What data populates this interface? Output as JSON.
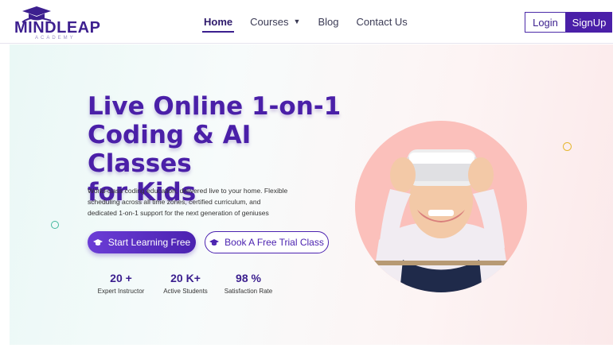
{
  "brand": {
    "name": "MINDLEAP",
    "sub": "ACADEMY",
    "accent": "#4a1fa8"
  },
  "nav": {
    "items": [
      {
        "label": "Home",
        "active": true
      },
      {
        "label": "Courses",
        "dropdown": true
      },
      {
        "label": "Blog"
      },
      {
        "label": "Contact Us"
      }
    ]
  },
  "auth": {
    "login": "Login",
    "signup": "SignUp"
  },
  "hero": {
    "title_line1": "Live Online 1-on-1",
    "title_line2": "Coding & AI Classes",
    "title_line3": "for Kids",
    "desc_line1": "World-class coding education, delivered live to your home. Flexible",
    "desc_line2": "scheduling across all time zones, certified curriculum, and",
    "desc_line3": "dedicated 1-on-1 support for the next generation of geniuses",
    "cta_primary": "Start Learning Free",
    "cta_secondary": "Book A Free Trial Class",
    "image_alt": "child-with-vr-headset"
  },
  "stats": [
    {
      "value": "20 +",
      "label": "Expert Instructor"
    },
    {
      "value": "20 K+",
      "label": "Active Students"
    },
    {
      "value": "98 %",
      "label": "Satisfaction Rate"
    }
  ]
}
